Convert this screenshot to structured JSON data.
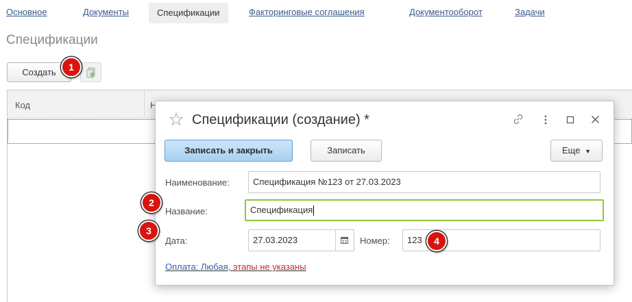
{
  "tabs": [
    {
      "label": "Основное"
    },
    {
      "label": "Документы"
    },
    {
      "label": "Спецификации"
    },
    {
      "label": "Факторинговые соглашения"
    },
    {
      "label": "Документооборот"
    },
    {
      "label": "Задачи"
    }
  ],
  "page_title": "Спецификации",
  "toolbar": {
    "create_label": "Создать"
  },
  "list": {
    "columns": [
      "Код",
      "Н"
    ]
  },
  "badges": [
    "1",
    "2",
    "3",
    "4"
  ],
  "dialog": {
    "title": "Спецификации (создание) *",
    "save_close_label": "Записать и закрыть",
    "save_label": "Записать",
    "more_label": "Еще",
    "naming_label": "Наименование:",
    "naming_value": "Спецификация №123 от 27.03.2023",
    "name_label": "Название:",
    "name_value": "Спецификация",
    "date_label": "Дата:",
    "date_value": "27.03.2023",
    "number_label": "Номер:",
    "number_value": "123",
    "payment_link": {
      "part1": "Оплата: Любая, ",
      "part2": "этапы не указаны"
    }
  },
  "colors": {
    "link": "#3b5a8a",
    "link_blue": "#2f5fb5",
    "link_red": "#c8282a",
    "accent": "#8cc63e",
    "badge": "#d8140f"
  }
}
